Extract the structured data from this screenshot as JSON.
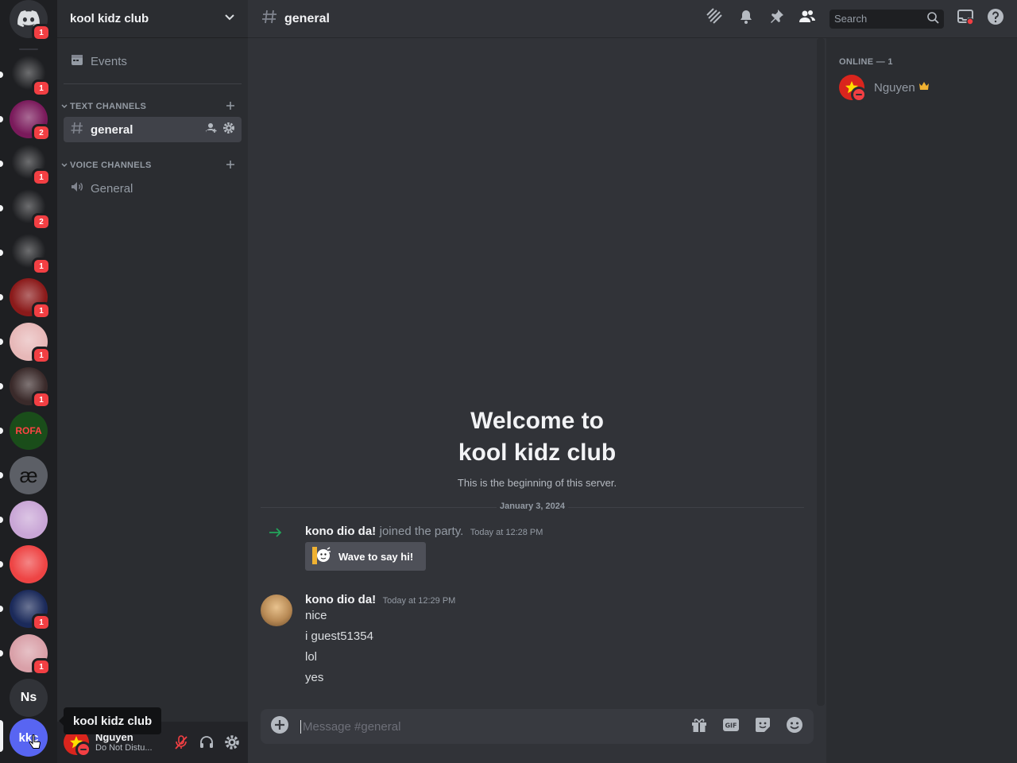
{
  "server": {
    "name": "kool kidz club",
    "tooltip": "kool kidz club",
    "icon_initials": "kkc"
  },
  "rail": {
    "home_badge": "1",
    "servers": [
      {
        "badge": "1",
        "color": "#1e1f22"
      },
      {
        "badge": "2",
        "color": "#7a1a5b"
      },
      {
        "badge": "1",
        "color": "#1e1f22"
      },
      {
        "badge": "2",
        "color": "#1e1f22"
      },
      {
        "badge": "1",
        "color": "#1e1f22"
      },
      {
        "badge": "1",
        "color": "#8b1a1a"
      },
      {
        "badge": "1",
        "color": "#e7b8b8"
      },
      {
        "badge": "1",
        "color": "#3a2a2a"
      },
      {
        "badge": "",
        "color": "#1a4d1a",
        "text": "ROFA"
      },
      {
        "badge": "",
        "color": "#5c5f66",
        "text": "æ"
      },
      {
        "badge": "",
        "color": "#c9a6d6"
      },
      {
        "badge": "",
        "color": "#ee4444"
      },
      {
        "badge": "1",
        "color": "#1b2a5a"
      },
      {
        "badge": "1",
        "color": "#d9a0a8"
      },
      {
        "badge": "",
        "color": "#313338",
        "text": "Ns"
      }
    ]
  },
  "sidebar": {
    "events_label": "Events",
    "text_category": "TEXT CHANNELS",
    "voice_category": "VOICE CHANNELS",
    "text_channels": [
      {
        "name": "general"
      }
    ],
    "voice_channels": [
      {
        "name": "General"
      }
    ]
  },
  "user": {
    "name": "Nguyen",
    "status": "Do Not Distu..."
  },
  "topbar": {
    "channel": "general",
    "search_placeholder": "Search"
  },
  "welcome": {
    "title_line1": "Welcome to",
    "title_line2": "kool kidz club",
    "subtitle": "This is the beginning of this server."
  },
  "date_divider": "January 3, 2024",
  "messages": {
    "join": {
      "author": "kono dio da!",
      "text": "joined the party.",
      "timestamp": "Today at 12:28 PM",
      "wave_label": "Wave to say hi!"
    },
    "post": {
      "author": "kono dio da!",
      "timestamp": "Today at 12:29 PM",
      "lines": [
        "nice",
        "i guest51354",
        "lol",
        "yes"
      ]
    }
  },
  "composer": {
    "placeholder": "Message #general"
  },
  "members": {
    "header": "ONLINE — 1",
    "list": [
      {
        "name": "Nguyen",
        "status": "dnd"
      }
    ]
  },
  "colors": {
    "accent": "#5865f2",
    "dnd": "#f23f43",
    "join_arrow": "#23a55a",
    "crown": "#f0b232"
  }
}
